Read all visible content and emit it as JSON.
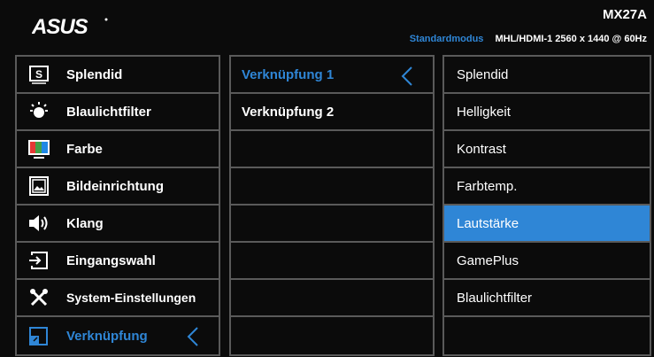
{
  "header": {
    "brand": "ASUS",
    "model": "MX27A",
    "mode": "Standardmodus",
    "input_info": "MHL/HDMI-1  2560 x 1440 @ 60Hz"
  },
  "main_menu": {
    "items": [
      {
        "label": "Splendid",
        "icon": "splendid-icon"
      },
      {
        "label": "Blaulichtfilter",
        "icon": "blue-light-icon"
      },
      {
        "label": "Farbe",
        "icon": "color-icon"
      },
      {
        "label": "Bildeinrichtung",
        "icon": "image-icon"
      },
      {
        "label": "Klang",
        "icon": "speaker-icon"
      },
      {
        "label": "Eingangswahl",
        "icon": "input-icon"
      },
      {
        "label": "System-Einstellungen",
        "icon": "tools-icon"
      },
      {
        "label": "Verknüpfung",
        "icon": "shortcut-icon",
        "selected": true
      }
    ]
  },
  "submenu": {
    "items": [
      {
        "label": "Verknüpfung 1",
        "selected": true
      },
      {
        "label": "Verknüpfung 2"
      }
    ]
  },
  "options": {
    "items": [
      {
        "label": "Splendid"
      },
      {
        "label": "Helligkeit"
      },
      {
        "label": "Kontrast"
      },
      {
        "label": "Farbtemp."
      },
      {
        "label": "Lautstärke",
        "selected": true
      },
      {
        "label": "GamePlus"
      },
      {
        "label": "Blaulichtfilter"
      }
    ]
  },
  "colors": {
    "accent": "#2f86d6",
    "border": "#5a5a5a",
    "background": "#0b0b0b"
  }
}
